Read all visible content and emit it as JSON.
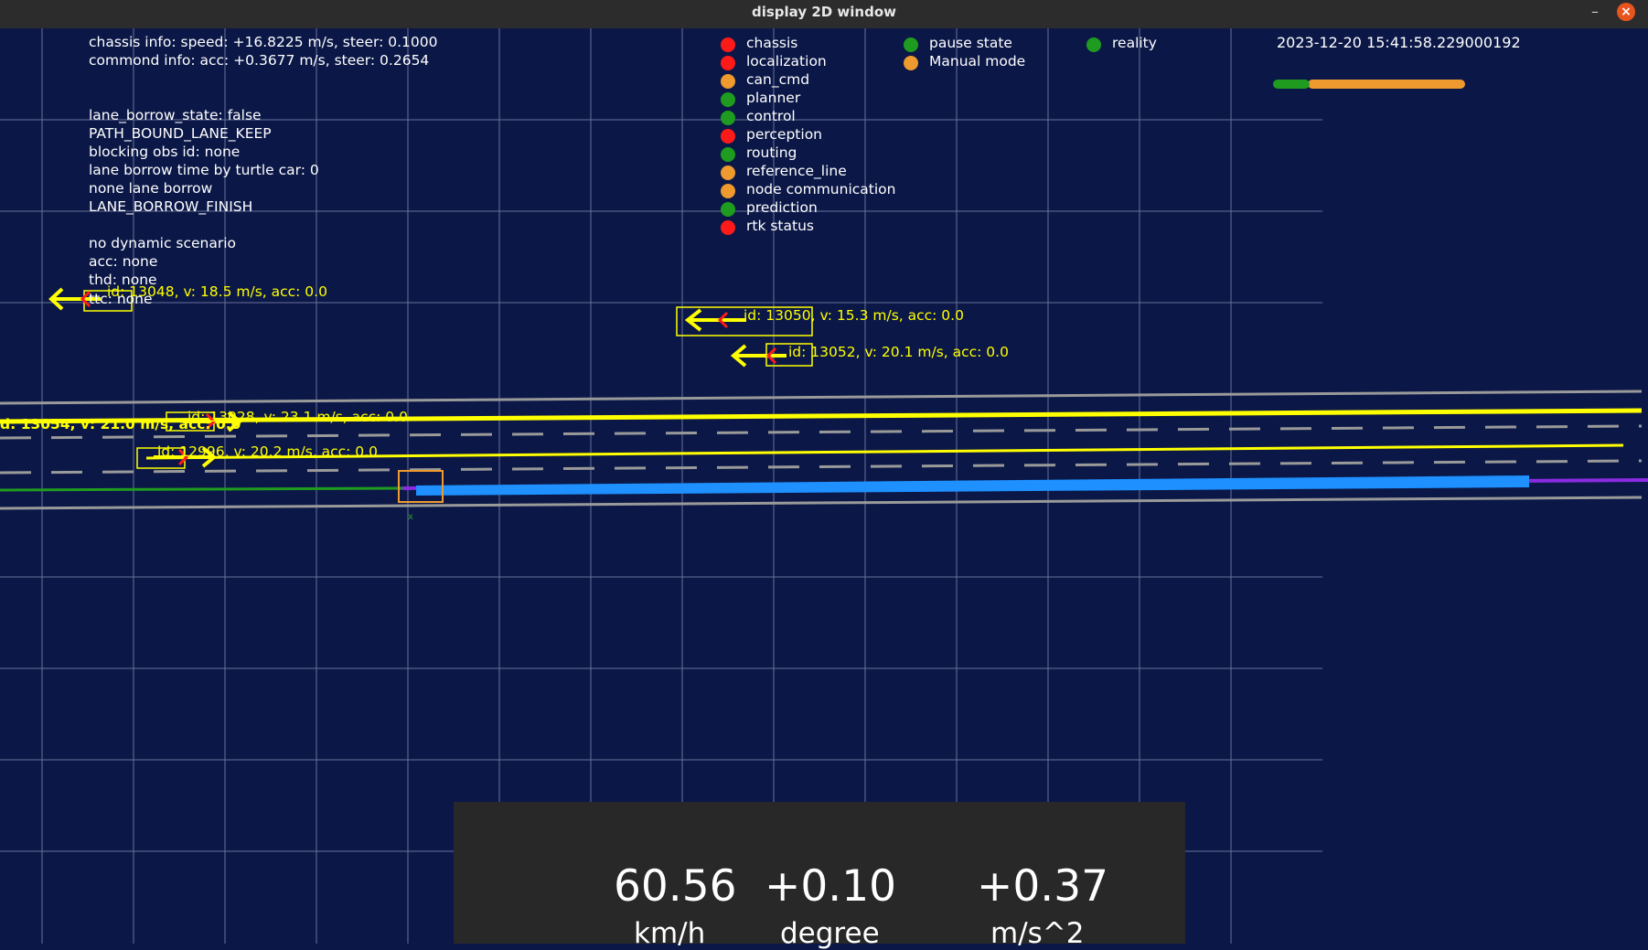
{
  "window": {
    "title": "display 2D window"
  },
  "theme": {
    "background": "#0b1847",
    "grid_color": "#8a8fb3",
    "lane_gray": "#9a9a9a",
    "path_yellow": "#ffff00",
    "plan_blue": "#1e90ff",
    "ref_purple": "#8a2be2",
    "red": "#ff1a1a",
    "green": "#1f9c1f",
    "orange": "#ee9a2e"
  },
  "info": {
    "chassis": "chassis info: speed: +16.8225 m/s, steer: 0.1000",
    "command": "commond info: acc: +0.3677 m/s, steer: 0.2654",
    "lane_borrow_state": "lane_borrow_state: false",
    "path_bound": "PATH_BOUND_LANE_KEEP",
    "blocking": "blocking obs id: none",
    "turtle": "lane borrow time by turtle car: 0",
    "none_borrow": "none lane borrow",
    "borrow_finish": "LANE_BORROW_FINISH",
    "scenario": "no dynamic scenario",
    "acc": "acc: none",
    "thd": "thd: none",
    "ttc": "ttc: none"
  },
  "modules": [
    {
      "name": "chassis",
      "status": "red"
    },
    {
      "name": "localization",
      "status": "red"
    },
    {
      "name": "can_cmd",
      "status": "orange"
    },
    {
      "name": "planner",
      "status": "green"
    },
    {
      "name": "control",
      "status": "green"
    },
    {
      "name": "perception",
      "status": "red"
    },
    {
      "name": "routing",
      "status": "green"
    },
    {
      "name": "reference_line",
      "status": "orange"
    },
    {
      "name": "node communication",
      "status": "orange"
    },
    {
      "name": "prediction",
      "status": "green"
    },
    {
      "name": "rtk status",
      "status": "red"
    }
  ],
  "states": [
    {
      "name": "pause state",
      "status": "green"
    },
    {
      "name": "Manual mode",
      "status": "orange"
    },
    {
      "name": "reality",
      "status": "green"
    }
  ],
  "timestamp": "2023-12-20 15:41:58.229000192",
  "obstacles": [
    {
      "label": "id: 13048, v: 18.5 m/s, acc: 0.0"
    },
    {
      "label": "id: 13050, v: 15.3 m/s, acc: 0.0"
    },
    {
      "label": "id: 13052, v: 20.1 m/s, acc: 0.0"
    },
    {
      "label": "d: 13054, v: 21.0 m/s, acc: 0.0"
    },
    {
      "label": "id: 13028, v: 23.1 m/s, acc: 0.0"
    },
    {
      "label": "id: 12996, v: 20.2 m/s, acc: 0.0"
    }
  ],
  "dashboard": {
    "speed_value": "60.56",
    "speed_unit": "km/h",
    "steer_value": "+0.10",
    "steer_unit": "degree",
    "acc_value": "+0.37",
    "acc_unit": "m/s^2"
  }
}
